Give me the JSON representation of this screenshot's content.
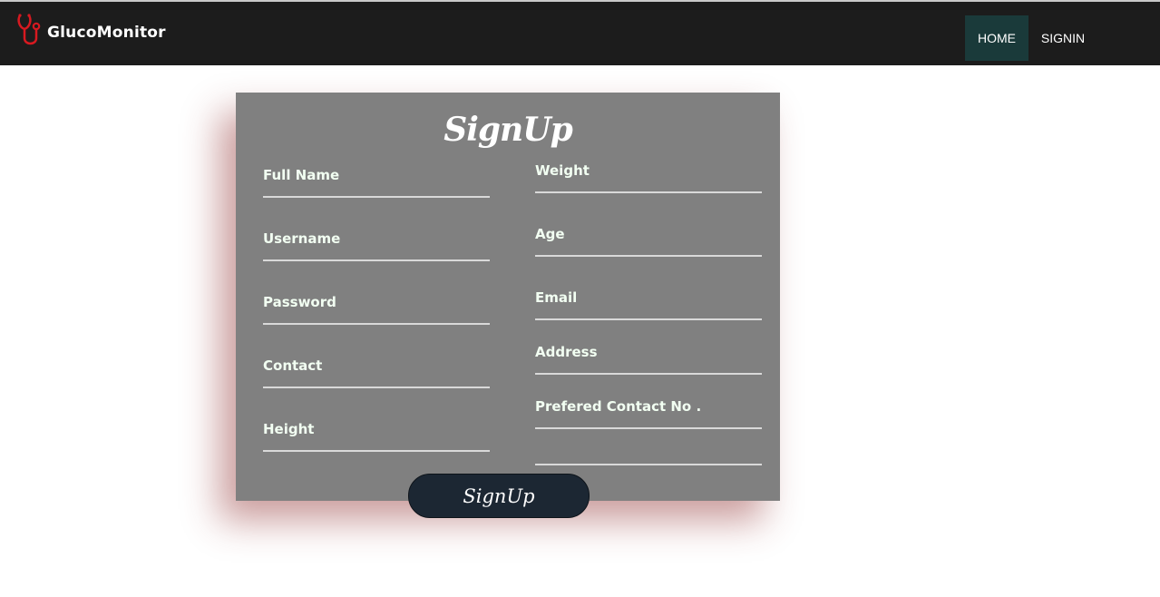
{
  "brand": {
    "name": "GlucoMonitor",
    "icon": "stethoscope-icon",
    "icon_color": "#d71920"
  },
  "nav": {
    "home": "HOME",
    "signin": "SIGNIN",
    "active_color": "#1a3a3a"
  },
  "form": {
    "title": "SignUp",
    "left_fields": [
      {
        "label": "Full Name",
        "value": ""
      },
      {
        "label": "Username",
        "value": ""
      },
      {
        "label": "Password",
        "value": ""
      },
      {
        "label": "Contact",
        "value": ""
      },
      {
        "label": "Height",
        "value": ""
      }
    ],
    "right_fields": [
      {
        "label": "Weight",
        "value": ""
      },
      {
        "label": "Age",
        "value": ""
      },
      {
        "label": "Email",
        "value": ""
      },
      {
        "label": "Address",
        "value": ""
      },
      {
        "label": "Prefered Contact No .",
        "value": ""
      },
      {
        "label": "",
        "value": ""
      }
    ],
    "submit_label": "SignUp"
  }
}
